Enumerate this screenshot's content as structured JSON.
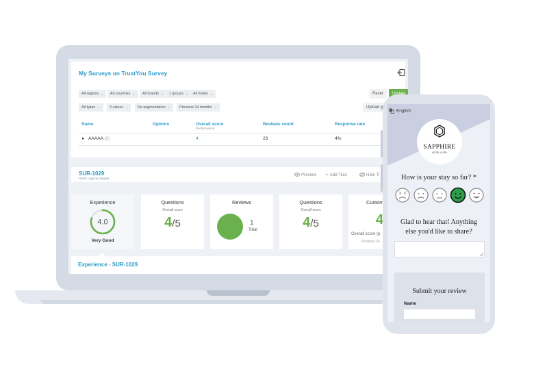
{
  "dashboard": {
    "title": "My Surveys on TrustYou Survey",
    "filters_row1": [
      "All regions",
      "All countries",
      "All brands",
      "1 groups",
      "All hotels"
    ],
    "filters_row2": [
      "All types",
      "3 values",
      "No segmentation",
      "Previous 24 months"
    ],
    "reset_label": "Reset",
    "update_label": "Update",
    "upload_label": "Upload gu",
    "table": {
      "headers": {
        "name": "Name",
        "options": "Options",
        "overall_score": "Overall score",
        "overall_score_sub": "Performance",
        "reviews_count": "Reviews count",
        "response_rate": "Response rate"
      },
      "row": {
        "name": "AAAAA",
        "count": "(2)",
        "overall_score": "4",
        "reviews_count": "23",
        "response_rate": "4%"
      }
    },
    "survey": {
      "id": "SUR-1029",
      "hotel": "Hotel Laguna Zagreb",
      "preview_label": "Preview",
      "add_tiles_label": "Add Tiles",
      "hide_tiles_label": "Hide Ti"
    },
    "tiles": {
      "experience": {
        "title": "Experience",
        "score": "4.0",
        "label": "Very Good",
        "fraction": 0.8
      },
      "questions1": {
        "title": "Questions",
        "sub": "Overall score",
        "score": "4",
        "denominator": "/5"
      },
      "reviews": {
        "title": "Reviews",
        "count": "1",
        "sub": "Total"
      },
      "questions2": {
        "title": "Questions",
        "sub": "Overall score",
        "score": "4",
        "denominator": "/5"
      },
      "custom": {
        "title": "Custom",
        "score": "4",
        "sub": "Overall score (p",
        "sub2": "Previous 24"
      }
    },
    "experience_section_title": "Experience - SUR-1029"
  },
  "phone": {
    "language": "English",
    "logo_word": "SAPPHIRE",
    "logo_sub": "HOTEL & SPA",
    "question1": "How is your stay so far? *",
    "faces": [
      "very-sad-face-icon",
      "sad-face-icon",
      "neutral-face-icon",
      "happy-face-icon",
      "very-happy-face-icon"
    ],
    "selected_face_index": 3,
    "question2": "Glad to hear that! Anything else you'd like to share?",
    "submit_title": "Submit your review",
    "name_label": "Name"
  },
  "colors": {
    "accent_blue": "#2a9bc9",
    "accent_green": "#6ab04c",
    "selected_face": "#2e9e4a"
  }
}
